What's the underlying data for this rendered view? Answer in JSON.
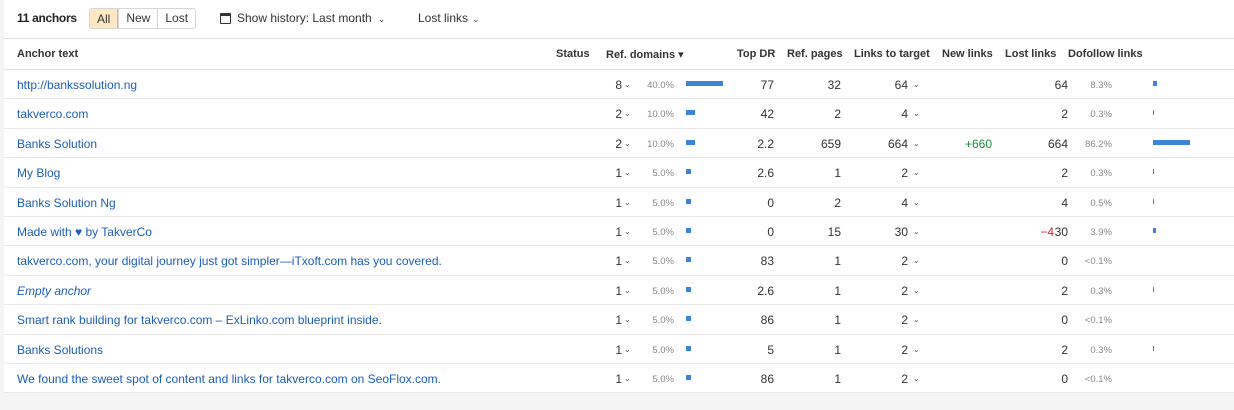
{
  "toolbar": {
    "count_label": "11 anchors",
    "filters": [
      "All",
      "New",
      "Lost"
    ],
    "active_filter": "All",
    "history_label": "Show history: Last month",
    "lost_links_label": "Lost links",
    "icons": {
      "calendar": "calendar-icon",
      "chevron": "chevron-down-icon"
    }
  },
  "columns": {
    "anchor": "Anchor text",
    "status": "Status",
    "ref_domains": "Ref. domains ▾",
    "top_dr": "Top DR",
    "ref_pages": "Ref. pages",
    "links_to_target": "Links to target",
    "new_links": "New links",
    "lost_links": "Lost links",
    "dofollow": "Dofollow links"
  },
  "colors": {
    "link": "#1b5eb8",
    "bar": "#3c84d6",
    "active_bg": "#fde8c3",
    "active_border": "#f6b34a",
    "positive": "#1d8a3c",
    "negative": "#d0282d"
  },
  "rows": [
    {
      "anchor": "http://bankssolution.ng",
      "italic": false,
      "ref_domains": "8",
      "ref_domains_pct": "40.0%",
      "ref_domains_share": 0.4,
      "top_dr": "77",
      "ref_pages": "32",
      "links_to_target": "64",
      "new_links": "",
      "lost_links": "",
      "dofollow": "64",
      "dofollow_pct": "8.3%",
      "dofollow_share": 0.083
    },
    {
      "anchor": "takverco.com",
      "italic": false,
      "ref_domains": "2",
      "ref_domains_pct": "10.0%",
      "ref_domains_share": 0.1,
      "top_dr": "42",
      "ref_pages": "2",
      "links_to_target": "4",
      "new_links": "",
      "lost_links": "",
      "dofollow": "2",
      "dofollow_pct": "0.3%",
      "dofollow_share": 0.003
    },
    {
      "anchor": "Banks Solution",
      "italic": false,
      "ref_domains": "2",
      "ref_domains_pct": "10.0%",
      "ref_domains_share": 0.1,
      "top_dr": "2.2",
      "ref_pages": "659",
      "links_to_target": "664",
      "new_links": "+660",
      "lost_links": "",
      "dofollow": "664",
      "dofollow_pct": "86.2%",
      "dofollow_share": 0.862
    },
    {
      "anchor": "My Blog",
      "italic": false,
      "ref_domains": "1",
      "ref_domains_pct": "5.0%",
      "ref_domains_share": 0.05,
      "top_dr": "2.6",
      "ref_pages": "1",
      "links_to_target": "2",
      "new_links": "",
      "lost_links": "",
      "dofollow": "2",
      "dofollow_pct": "0.3%",
      "dofollow_share": 0.003
    },
    {
      "anchor": "Banks Solution Ng",
      "italic": false,
      "ref_domains": "1",
      "ref_domains_pct": "5.0%",
      "ref_domains_share": 0.05,
      "top_dr": "0",
      "ref_pages": "2",
      "links_to_target": "4",
      "new_links": "",
      "lost_links": "",
      "dofollow": "4",
      "dofollow_pct": "0.5%",
      "dofollow_share": 0.005
    },
    {
      "anchor": "Made with ♥ by TakverCo",
      "italic": false,
      "ref_domains": "1",
      "ref_domains_pct": "5.0%",
      "ref_domains_share": 0.05,
      "top_dr": "0",
      "ref_pages": "15",
      "links_to_target": "30",
      "new_links": "",
      "lost_links": "−4",
      "dofollow": "30",
      "dofollow_pct": "3.9%",
      "dofollow_share": 0.039
    },
    {
      "anchor": "takverco.com, your digital journey just got simpler—iTxoft.com has you covered.",
      "italic": false,
      "ref_domains": "1",
      "ref_domains_pct": "5.0%",
      "ref_domains_share": 0.05,
      "top_dr": "83",
      "ref_pages": "1",
      "links_to_target": "2",
      "new_links": "",
      "lost_links": "",
      "dofollow": "0",
      "dofollow_pct": "<0.1%",
      "dofollow_share": 0
    },
    {
      "anchor": "Empty anchor",
      "italic": true,
      "ref_domains": "1",
      "ref_domains_pct": "5.0%",
      "ref_domains_share": 0.05,
      "top_dr": "2.6",
      "ref_pages": "1",
      "links_to_target": "2",
      "new_links": "",
      "lost_links": "",
      "dofollow": "2",
      "dofollow_pct": "0.3%",
      "dofollow_share": 0.003
    },
    {
      "anchor": "Smart rank building for takverco.com – ExLinko.com blueprint inside.",
      "italic": false,
      "ref_domains": "1",
      "ref_domains_pct": "5.0%",
      "ref_domains_share": 0.05,
      "top_dr": "86",
      "ref_pages": "1",
      "links_to_target": "2",
      "new_links": "",
      "lost_links": "",
      "dofollow": "0",
      "dofollow_pct": "<0.1%",
      "dofollow_share": 0
    },
    {
      "anchor": "Banks Solutions",
      "italic": false,
      "ref_domains": "1",
      "ref_domains_pct": "5.0%",
      "ref_domains_share": 0.05,
      "top_dr": "5",
      "ref_pages": "1",
      "links_to_target": "2",
      "new_links": "",
      "lost_links": "",
      "dofollow": "2",
      "dofollow_pct": "0.3%",
      "dofollow_share": 0.003
    },
    {
      "anchor": "We found the sweet spot of content and links for takverco.com on SeoFlox.com.",
      "italic": false,
      "ref_domains": "1",
      "ref_domains_pct": "5.0%",
      "ref_domains_share": 0.05,
      "top_dr": "86",
      "ref_pages": "1",
      "links_to_target": "2",
      "new_links": "",
      "lost_links": "",
      "dofollow": "0",
      "dofollow_pct": "<0.1%",
      "dofollow_share": 0
    }
  ]
}
